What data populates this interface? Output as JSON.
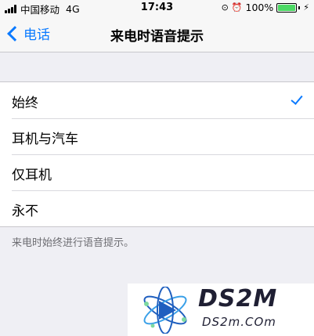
{
  "status_bar": {
    "carrier": "中国移动",
    "network": "4G",
    "time": "17:43",
    "battery_percent": "100%",
    "battery_level": 1.0,
    "icons": [
      "signal-icon",
      "location-icon",
      "alarm-icon",
      "battery-icon",
      "charging-icon"
    ]
  },
  "nav": {
    "back_label": "电话",
    "title": "来电时语音提示"
  },
  "options": [
    {
      "label": "始终",
      "selected": true
    },
    {
      "label": "耳机与汽车",
      "selected": false
    },
    {
      "label": "仅耳机",
      "selected": false
    },
    {
      "label": "永不",
      "selected": false
    }
  ],
  "footer_note": "来电时始终进行语音提示。",
  "watermark": {
    "brand": "DS2M",
    "domain": "DS2m.COm"
  },
  "colors": {
    "accent": "#0a7aff",
    "background": "#efeff4",
    "battery": "#4cd964"
  }
}
